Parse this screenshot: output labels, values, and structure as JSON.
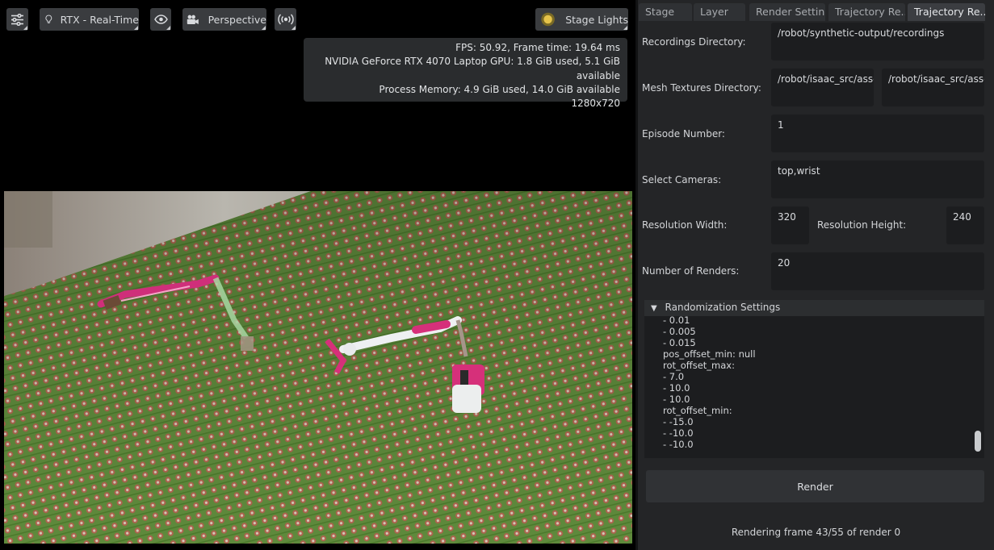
{
  "viewport": {
    "toolbar": {
      "renderer_label": "RTX - Real-Time",
      "camera_label": "Perspective",
      "lights_label": "Stage Lights"
    },
    "stats": {
      "line1": "FPS: 50.92, Frame time: 19.64 ms",
      "line2": "NVIDIA GeForce RTX 4070 Laptop GPU: 1.8 GiB used, 5.1 GiB available",
      "line3": "Process Memory: 4.9 GiB used, 14.0 GiB available",
      "line4": "1280x720"
    }
  },
  "tabs": [
    "Stage",
    "Layer",
    "Render Settin...",
    "Trajectory Re...",
    "Trajectory Re..."
  ],
  "form": {
    "recordings_dir": {
      "label": "Recordings Directory:",
      "value": "/robot/synthetic-output/recordings"
    },
    "mesh_textures_dir": {
      "label": "Mesh Textures Directory:",
      "value1": "/robot/isaac_src/asse",
      "value2": "/robot/isaac_src/asse"
    },
    "episode_number": {
      "label": "Episode Number:",
      "value": "1"
    },
    "select_cameras": {
      "label": "Select Cameras:",
      "value": "top,wrist"
    },
    "resolution_width": {
      "label": "Resolution Width:",
      "value": "320"
    },
    "resolution_height": {
      "label": "Resolution Height:",
      "value": "240"
    },
    "number_of_renders": {
      "label": "Number of Renders:",
      "value": "20"
    }
  },
  "randomization": {
    "title": "Randomization Settings",
    "lines": [
      "- 0.01",
      "- 0.005",
      "- 0.015",
      "pos_offset_min: null",
      "rot_offset_max:",
      "- 7.0",
      "- 10.0",
      "- 10.0",
      "rot_offset_min:",
      "- -15.0",
      "- -10.0",
      "- -10.0"
    ]
  },
  "render_button": "Render",
  "status_text": "Rendering frame 43/55 of render 0",
  "colors": {
    "panel_bg": "#242527",
    "field_bg": "#1c1d1f",
    "active_tab": "#3b3d41",
    "robot_magenta": "#d6307a"
  }
}
